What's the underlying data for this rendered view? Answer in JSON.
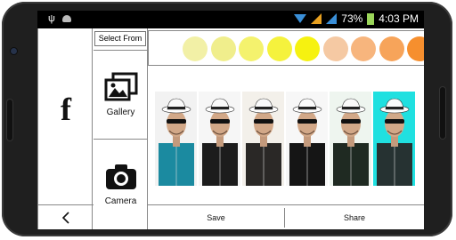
{
  "status": {
    "battery_pct": "73%",
    "time": "4:03",
    "time_suffix": "PM",
    "icons": [
      "usb-icon",
      "android-icon",
      "wifi-icon",
      "signal-icon",
      "signal-icon",
      "battery-icon"
    ]
  },
  "left": {
    "facebook_label": "f"
  },
  "source": {
    "select_from": "Select From",
    "gallery": "Gallery",
    "camera": "Camera"
  },
  "swatches": [
    {
      "color": "#f2f0a6"
    },
    {
      "color": "#f0ee8c"
    },
    {
      "color": "#f4f26d"
    },
    {
      "color": "#f5f23d"
    },
    {
      "color": "#f6f210"
    },
    {
      "color": "#f5c9a3"
    },
    {
      "color": "#f7b57d"
    },
    {
      "color": "#f7a45a"
    },
    {
      "color": "#f68f2e"
    }
  ],
  "filters": [
    {
      "name": "cyan-tint",
      "shirt": "#1b8aa0",
      "bg": "#f2f2f2"
    },
    {
      "name": "black-white",
      "shirt": "#1c1c1c",
      "bg": "#f6f6f6"
    },
    {
      "name": "sepia",
      "shirt": "#2a2826",
      "bg": "#f3f0ea"
    },
    {
      "name": "mono",
      "shirt": "#151515",
      "bg": "#f7f7f7"
    },
    {
      "name": "green-tint",
      "shirt": "#1f2a22",
      "bg": "#eef5ef"
    },
    {
      "name": "cyan-bg",
      "shirt": "#263232",
      "bg": "#20e0e0"
    }
  ],
  "actions": {
    "save": "Save",
    "share": "Share"
  }
}
